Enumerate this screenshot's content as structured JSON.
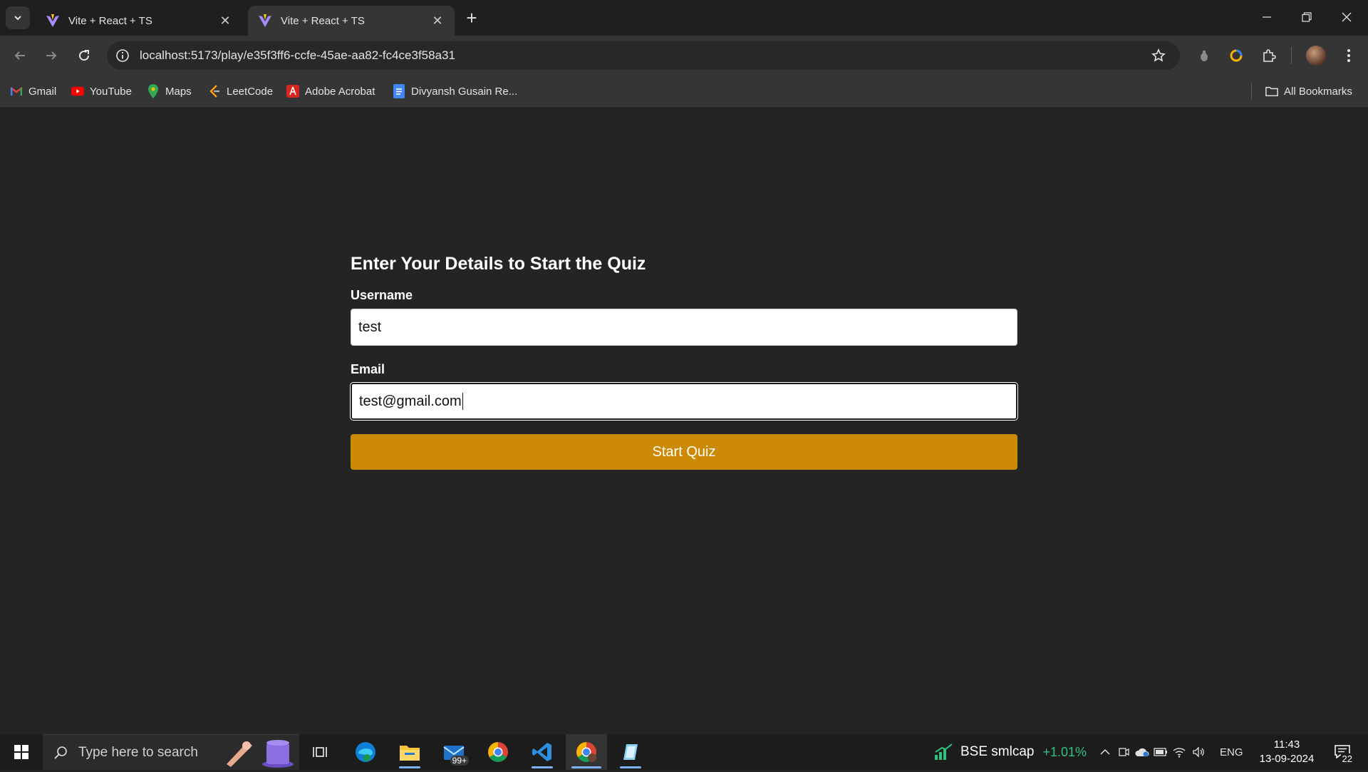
{
  "browser": {
    "tabs": [
      {
        "title": "Vite + React + TS",
        "active": false
      },
      {
        "title": "Vite + React + TS",
        "active": true
      }
    ],
    "url": "localhost:5173/play/e35f3ff6-ccfe-45ae-aa82-fc4ce3f58a31",
    "bookmarks": [
      {
        "label": "Gmail",
        "icon": "gmail-icon"
      },
      {
        "label": "YouTube",
        "icon": "youtube-icon"
      },
      {
        "label": "Maps",
        "icon": "maps-icon"
      },
      {
        "label": "LeetCode",
        "icon": "leetcode-icon"
      },
      {
        "label": "Adobe Acrobat",
        "icon": "acrobat-icon"
      },
      {
        "label": "Divyansh Gusain Re...",
        "icon": "google-docs-icon"
      }
    ],
    "all_bookmarks": "All Bookmarks"
  },
  "page": {
    "heading": "Enter Your Details to Start the Quiz",
    "username_label": "Username",
    "username_value": "test",
    "email_label": "Email",
    "email_value": "test@gmail.com",
    "submit_label": "Start Quiz",
    "accent": "#cc8904",
    "background": "#242424"
  },
  "taskbar": {
    "search_placeholder": "Type here to search",
    "mail_badge": "99+",
    "stock_name": "BSE smlcap",
    "stock_change": "+1.01%",
    "language": "ENG",
    "time": "11:43",
    "date": "13-09-2024",
    "notifications": "22"
  }
}
